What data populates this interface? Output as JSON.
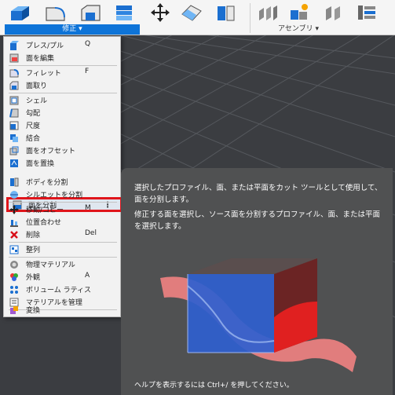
{
  "toolbar": {
    "modify_label": "修正 ▾",
    "assembly_label": "アセンブリ ▾",
    "icons": [
      "press-pull-icon",
      "fillet-icon",
      "chamfer-icon",
      "shell-icon",
      "move-icon",
      "split-face-icon",
      "split-body-icon",
      "joint-icon",
      "as-built-joint-icon",
      "joint-origin-icon",
      "rigid-group-icon"
    ]
  },
  "menu": {
    "items": [
      {
        "label": "プレス/プル",
        "shortcut": "Q",
        "icon": "press-pull-icon"
      },
      {
        "label": "面を編集",
        "shortcut": "",
        "icon": "edit-face-icon"
      },
      {
        "label": "フィレット",
        "shortcut": "F",
        "icon": "fillet-icon"
      },
      {
        "label": "面取り",
        "shortcut": "",
        "icon": "chamfer-icon"
      },
      {
        "label": "シェル",
        "shortcut": "",
        "icon": "shell-icon"
      },
      {
        "label": "勾配",
        "shortcut": "",
        "icon": "draft-icon"
      },
      {
        "label": "尺度",
        "shortcut": "",
        "icon": "scale-icon"
      },
      {
        "label": "結合",
        "shortcut": "",
        "icon": "combine-icon"
      },
      {
        "label": "面をオフセット",
        "shortcut": "",
        "icon": "offset-face-icon"
      },
      {
        "label": "面を置換",
        "shortcut": "",
        "icon": "replace-face-icon"
      },
      {
        "label": "面を分割",
        "shortcut": "",
        "icon": "split-face-icon"
      },
      {
        "label": "ボディを分割",
        "shortcut": "",
        "icon": "split-body-icon"
      },
      {
        "label": "シルエットを分割",
        "shortcut": "",
        "icon": "silhouette-split-icon"
      },
      {
        "label": "移動/コピー",
        "shortcut": "M",
        "icon": "move-icon"
      },
      {
        "label": "位置合わせ",
        "shortcut": "",
        "icon": "align-icon"
      },
      {
        "label": "削除",
        "shortcut": "Del",
        "icon": "delete-icon"
      },
      {
        "label": "整列",
        "shortcut": "",
        "icon": "arrange-icon"
      },
      {
        "label": "物理マテリアル",
        "shortcut": "",
        "icon": "physical-material-icon"
      },
      {
        "label": "外観",
        "shortcut": "A",
        "icon": "appearance-icon"
      },
      {
        "label": "ボリューム ラティス",
        "shortcut": "",
        "icon": "volumetric-lattice-icon"
      },
      {
        "label": "マテリアルを管理",
        "shortcut": "",
        "icon": "manage-materials-icon"
      },
      {
        "label": "変換",
        "shortcut": "",
        "icon": "convert-icon"
      }
    ],
    "more_glyph": "⋮"
  },
  "tooltip": {
    "line1": "選択したプロファイル、面、または平面をカット ツールとして使用して、面を分割します。",
    "line2": "修正する面を選択し、ソース面を分割するプロファイル、面、または平面を選択します。",
    "help": "ヘルプを表示するには Ctrl+/ を押してください。"
  },
  "colors": {
    "accent": "#0e74d8",
    "highlight_border": "#e0151b",
    "tooltip_bg": "#505152"
  }
}
